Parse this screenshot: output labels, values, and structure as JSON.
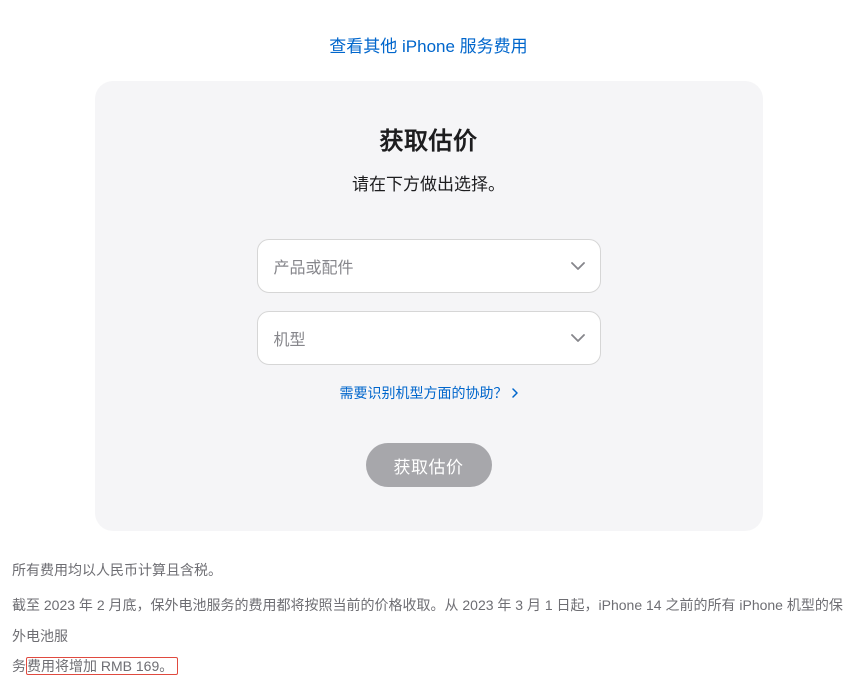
{
  "top_link": {
    "label": "查看其他 iPhone 服务费用"
  },
  "card": {
    "title": "获取估价",
    "subtitle": "请在下方做出选择。",
    "select_product_placeholder": "产品或配件",
    "select_model_placeholder": "机型",
    "help_link_label": "需要识别机型方面的协助？",
    "submit_label": "获取估价"
  },
  "footer": {
    "note1": "所有费用均以人民币计算且含税。",
    "note2_part1": "截至 2023 年 2 月底，保外电池服务的费用都将按照当前的价格收取。从 2023 年 3 月 1 日起，iPhone 14 之前的所有 iPhone 机型的保外电池服",
    "note2_highlighted_prefix": "务",
    "note2_highlighted": "费用将增加 RMB 169。"
  }
}
